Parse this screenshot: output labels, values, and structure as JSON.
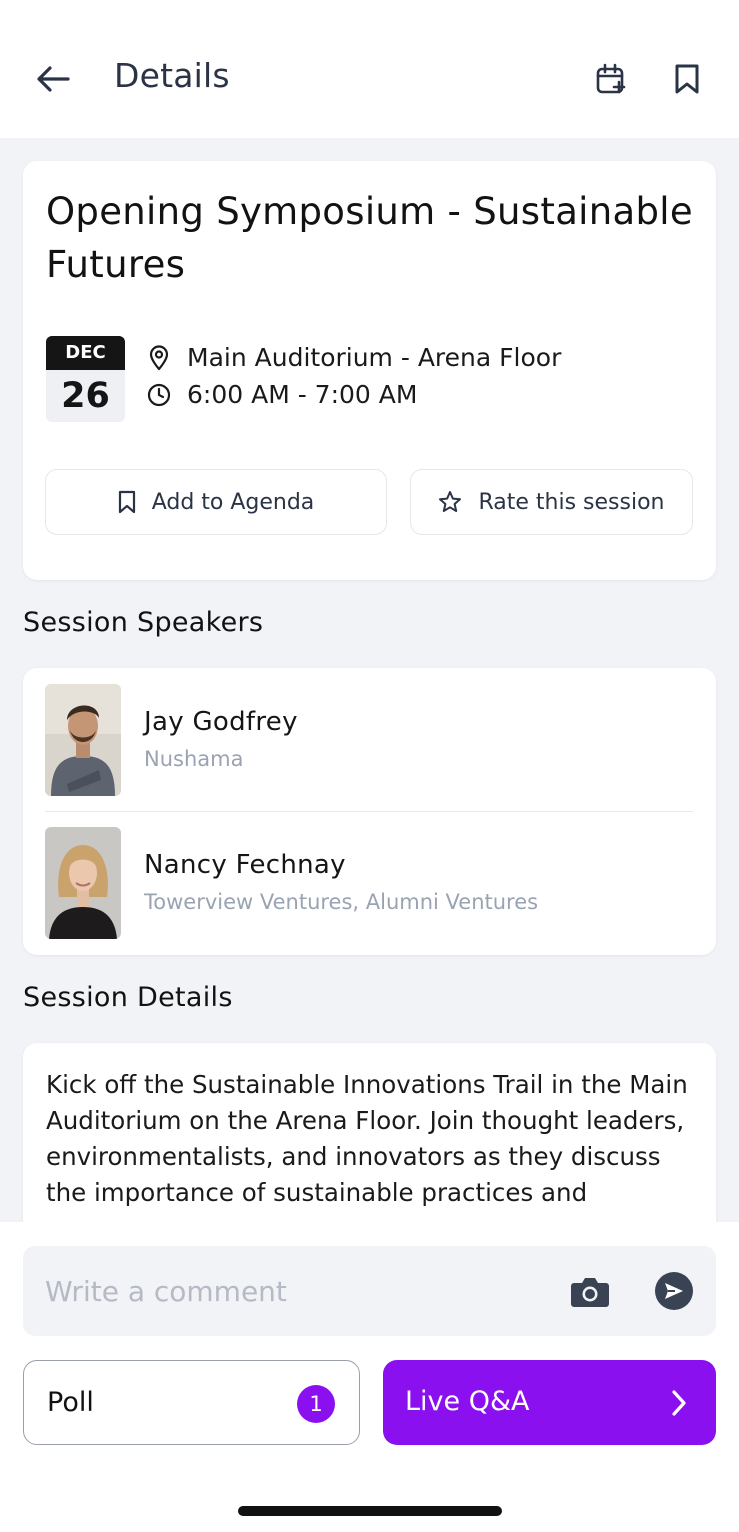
{
  "header": {
    "title": "Details",
    "back_icon": "arrow-left-icon",
    "calendar_icon": "calendar-plus-icon",
    "bookmark_icon": "bookmark-icon"
  },
  "session": {
    "title": "Opening Symposium - Sustainable Futures",
    "date_month": "DEC",
    "date_day": "26",
    "location": "Main Auditorium - Arena Floor",
    "time": "6:00 AM - 7:00 AM",
    "add_agenda_label": "Add to Agenda",
    "rate_label": "Rate this session"
  },
  "speakers_heading": "Session Speakers",
  "speakers": [
    {
      "name": "Jay Godfrey",
      "company": "Nushama"
    },
    {
      "name": "Nancy Fechnay",
      "company": "Towerview Ventures, Alumni Ventures"
    }
  ],
  "details_heading": "Session Details",
  "details_text": "Kick off the Sustainable Innovations Trail in the Main Auditorium on the Arena Floor. Join thought leaders, environmentalists, and innovators as they discuss the importance of sustainable practices and",
  "comment": {
    "placeholder": "Write a comment",
    "value": ""
  },
  "poll": {
    "label": "Poll",
    "badge": "1"
  },
  "qa": {
    "label": "Live Q&A"
  },
  "colors": {
    "accent": "#8b10f0",
    "background": "#f1f3f7",
    "muted_text": "#9aa3b2",
    "header_text": "#2b3446"
  }
}
